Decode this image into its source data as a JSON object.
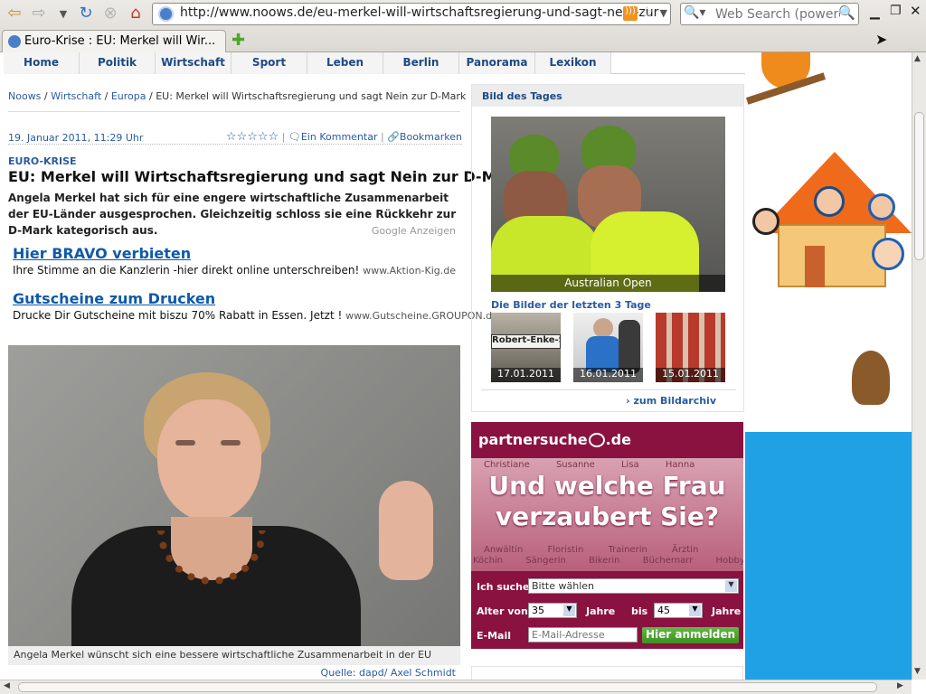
{
  "browser": {
    "url": "http://www.noows.de/eu-merkel-will-wirtschaftsregierung-und-sagt-nein-zur",
    "search_placeholder": "Web Search (powered",
    "tab_title": "Euro-Krise : EU: Merkel will Wir..."
  },
  "nav": [
    "Home",
    "Politik",
    "Wirtschaft",
    "Sport",
    "Leben",
    "Berlin",
    "Panorama",
    "Lexikon"
  ],
  "breadcrumb": {
    "items": [
      "Noows",
      "Wirtschaft",
      "Europa"
    ],
    "current": "EU: Merkel will Wirtschaftsregierung und sagt Nein zur D-Mark"
  },
  "article": {
    "date": "19. Januar 2011, 11:29 Uhr",
    "stars": "☆☆☆☆☆",
    "comment_label": "Ein Kommentar",
    "bookmark_label": "Bookmarken",
    "kicker": "EURO-KRISE",
    "headline": "EU: Merkel will Wirtschaftsregierung und sagt Nein zur D-Mark",
    "lead": "Angela Merkel hat sich für eine engere wirtschaftliche Zusammenarbeit der EU-Länder ausgesprochen. Gleichzeitig schloss sie eine Rückkehr zur D-Mark kategorisch aus.",
    "ads_label": "Google Anzeigen",
    "caption": "Angela Merkel wünscht sich eine bessere wirtschaftliche Zusammenarbeit in der EU",
    "source": "Quelle: dapd/ Axel Schmidt"
  },
  "ads": [
    {
      "title": "Hier BRAVO verbieten",
      "text": "Ihre Stimme an die Kanzlerin -hier direkt online unterschreiben!",
      "url": "www.Aktion-Kig.de"
    },
    {
      "title": "Gutscheine zum Drucken",
      "text": "Drucke Dir Gutscheine mit biszu 70% Rabatt in Essen. Jetzt !",
      "url": "www.Gutscheine.GROUPON.de"
    }
  ],
  "sidebar": {
    "bild_title": "Bild des Tages",
    "photo_caption": "Australian Open",
    "recent_title": "Die Bilder der letzten 3 Tage",
    "thumbs": [
      {
        "date": "17.01.2011",
        "sign": "Robert-Enke-Str."
      },
      {
        "date": "16.01.2011"
      },
      {
        "date": "15.01.2011"
      }
    ],
    "archive_link": "zum Bildarchiv"
  },
  "banner": {
    "logo_left": "partnersuche",
    "logo_right": ".de",
    "names": [
      "Christiane",
      "Susanne",
      "Lisa",
      "Hanna",
      "Anwältin",
      "Floristin",
      "Trainerin",
      "Ärztin",
      "Köchin",
      "Sängerin",
      "Bikerin",
      "Büchernarr",
      "Hobby"
    ],
    "headline1": "Und welche Frau",
    "headline2": "verzaubert Sie?",
    "search_label": "Ich suche",
    "search_value": "Bitte wählen",
    "age_label": "Alter von",
    "age_from": "35",
    "jahre1": "Jahre",
    "bis": "bis",
    "age_to": "45",
    "jahre2": "Jahre",
    "email_label": "E-Mail",
    "email_placeholder": "E-Mail-Adresse",
    "submit": "Hier anmelden"
  }
}
